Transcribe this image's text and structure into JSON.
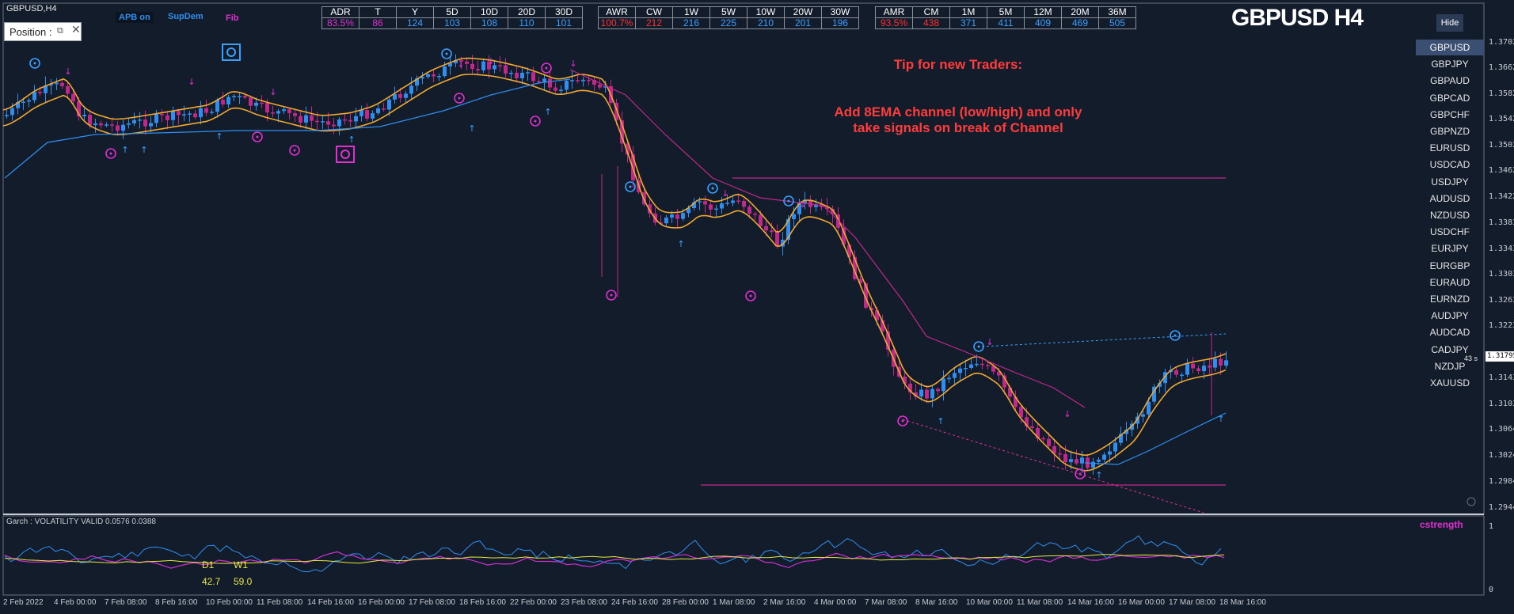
{
  "window_title": "GBPUSD,H4",
  "position_box": "Position :",
  "indicators": {
    "apb": "APB on",
    "supdem": "SupDem",
    "fib": "Fib"
  },
  "big_title": "GBPUSD H4",
  "hide_button": "Hide",
  "table1": {
    "headers": [
      "ADR",
      "T",
      "Y",
      "5D",
      "10D",
      "20D",
      "30D"
    ],
    "values": [
      "83.5%",
      "86",
      "124",
      "103",
      "108",
      "110",
      "101"
    ]
  },
  "table2": {
    "headers": [
      "AWR",
      "CW",
      "1W",
      "5W",
      "10W",
      "20W",
      "30W"
    ],
    "values": [
      "100.7%",
      "212",
      "216",
      "225",
      "210",
      "201",
      "196"
    ]
  },
  "table3": {
    "headers": [
      "AMR",
      "CM",
      "1M",
      "5M",
      "12M",
      "20M",
      "36M"
    ],
    "values": [
      "93.5%",
      "438",
      "371",
      "411",
      "409",
      "469",
      "505"
    ]
  },
  "tip": {
    "line1": "Tip for new Traders:",
    "line2": "Add 8EMA channel (low/high) and only",
    "line3": "take signals on break of Channel"
  },
  "symbols": [
    "GBPUSD",
    "GBPJPY",
    "GBPAUD",
    "GBPCAD",
    "GBPCHF",
    "GBPNZD",
    "EURUSD",
    "USDCAD",
    "USDJPY",
    "AUDUSD",
    "NZDUSD",
    "USDCHF",
    "EURJPY",
    "EURGBP",
    "EURAUD",
    "EURNZD",
    "AUDJPY",
    "AUDCAD",
    "CADJPY",
    "NZDJP",
    "XAUUSD"
  ],
  "active_symbol": "GBPUSD",
  "countdown": "43 s",
  "price_labels": [
    "1.37020",
    "1.36620",
    "1.35820",
    "1.35420",
    "1.35020",
    "1.34620",
    "1.34220",
    "1.33830",
    "1.33430",
    "1.33030",
    "1.32630",
    "1.32230",
    "1.31430",
    "1.31030",
    "1.30640",
    "1.30240",
    "1.29840",
    "1.29440"
  ],
  "current_price": "1.31795",
  "subwindow": {
    "label": "Garch : VOLATILITY VALID 0.0576 0.0388",
    "cstrength": "cstrength",
    "d1_label": "D1",
    "w1_label": "W1",
    "d1_value": "42.7",
    "w1_value": "59.0",
    "scale_top": "1",
    "scale_bottom": "0"
  },
  "time_labels": [
    "2 Feb 2022",
    "4 Feb 00:00",
    "7 Feb 08:00",
    "8 Feb 16:00",
    "10 Feb 00:00",
    "11 Feb 08:00",
    "14 Feb 16:00",
    "16 Feb 00:00",
    "17 Feb 08:00",
    "18 Feb 16:00",
    "22 Feb 00:00",
    "23 Feb 08:00",
    "24 Feb 16:00",
    "28 Feb 00:00",
    "1 Mar 08:00",
    "2 Mar 16:00",
    "4 Mar 00:00",
    "7 Mar 08:00",
    "8 Mar 16:00",
    "10 Mar 00:00",
    "11 Mar 08:00",
    "14 Mar 16:00",
    "16 Mar 00:00",
    "17 Mar 08:00",
    "18 Mar 16:00"
  ],
  "colors": {
    "bull": "#2f8ff0",
    "bear": "#c0288a",
    "ema": "#f0a830",
    "signal_up": "#3aa0ff",
    "signal_down": "#e030d0"
  }
}
